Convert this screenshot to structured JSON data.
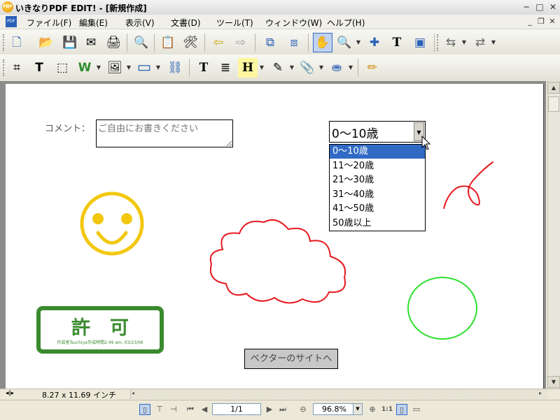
{
  "window": {
    "title": "いきなりPDF EDIT! - [新規作成]",
    "icon_label": "PDF",
    "minimize": "─",
    "restore": "□",
    "close": "✕"
  },
  "menubar": {
    "items": [
      "ファイル(F)",
      "編集(E)",
      "表示(V)",
      "文書(D)",
      "ツール(T)",
      "ウィンドウ(W)",
      "ヘルプ(H)"
    ],
    "doc_icon_label": "PDF",
    "mdi_minimize": "_",
    "mdi_restore": "❐",
    "mdi_close": "✕"
  },
  "toolbar1": {
    "new_pdf": "🗋",
    "open": "📂",
    "save": "💾",
    "email": "✉",
    "print": "🖨",
    "find": "🔍",
    "doc_props": "📋",
    "tools": "🛠",
    "back": "⇦",
    "forward": "⇨",
    "extract_pages": "⧉",
    "insert_pages": "⧈",
    "hand": "✋",
    "zoom": "🔍",
    "select": "✚",
    "text_select": "T",
    "snapshot": "▣",
    "rotate_pages": "⇆",
    "reorder": "⇄"
  },
  "toolbar2": {
    "crop": "⌗",
    "edit_text": "T",
    "edit_object": "⬚",
    "word_convert": "W",
    "image": "🖼",
    "shape_rect": "▭",
    "link": "⛓",
    "textbox": "T",
    "note": "≣",
    "header": "H",
    "pen": "✎",
    "attach": "📎",
    "stamp": "⛂",
    "highlighter": "✏"
  },
  "page": {
    "comment_label": "コメント：",
    "comment_placeholder": "ご自由にお書きください",
    "age_select": {
      "value": "0～10歳",
      "options": [
        "0～10歳",
        "11～20歳",
        "21～30歳",
        "31～40歳",
        "41～50歳",
        "50歳以上"
      ],
      "selected_index": 0
    },
    "stamp": {
      "title": "許可",
      "subtitle": "作成者Tsuchiya作成時間2:49 am, 03/23/06"
    },
    "vector_button": "ベクターのサイトへ",
    "colors": {
      "smiley": "#f2c80f",
      "cloud": "#e8191f",
      "scribble": "#e8191f",
      "ellipse": "#2ee02e",
      "stamp": "#3a8a2e"
    }
  },
  "status": {
    "page_size": "8.27 x 11.69 インチ",
    "page_number": "1/1",
    "zoom": "96.8%"
  }
}
